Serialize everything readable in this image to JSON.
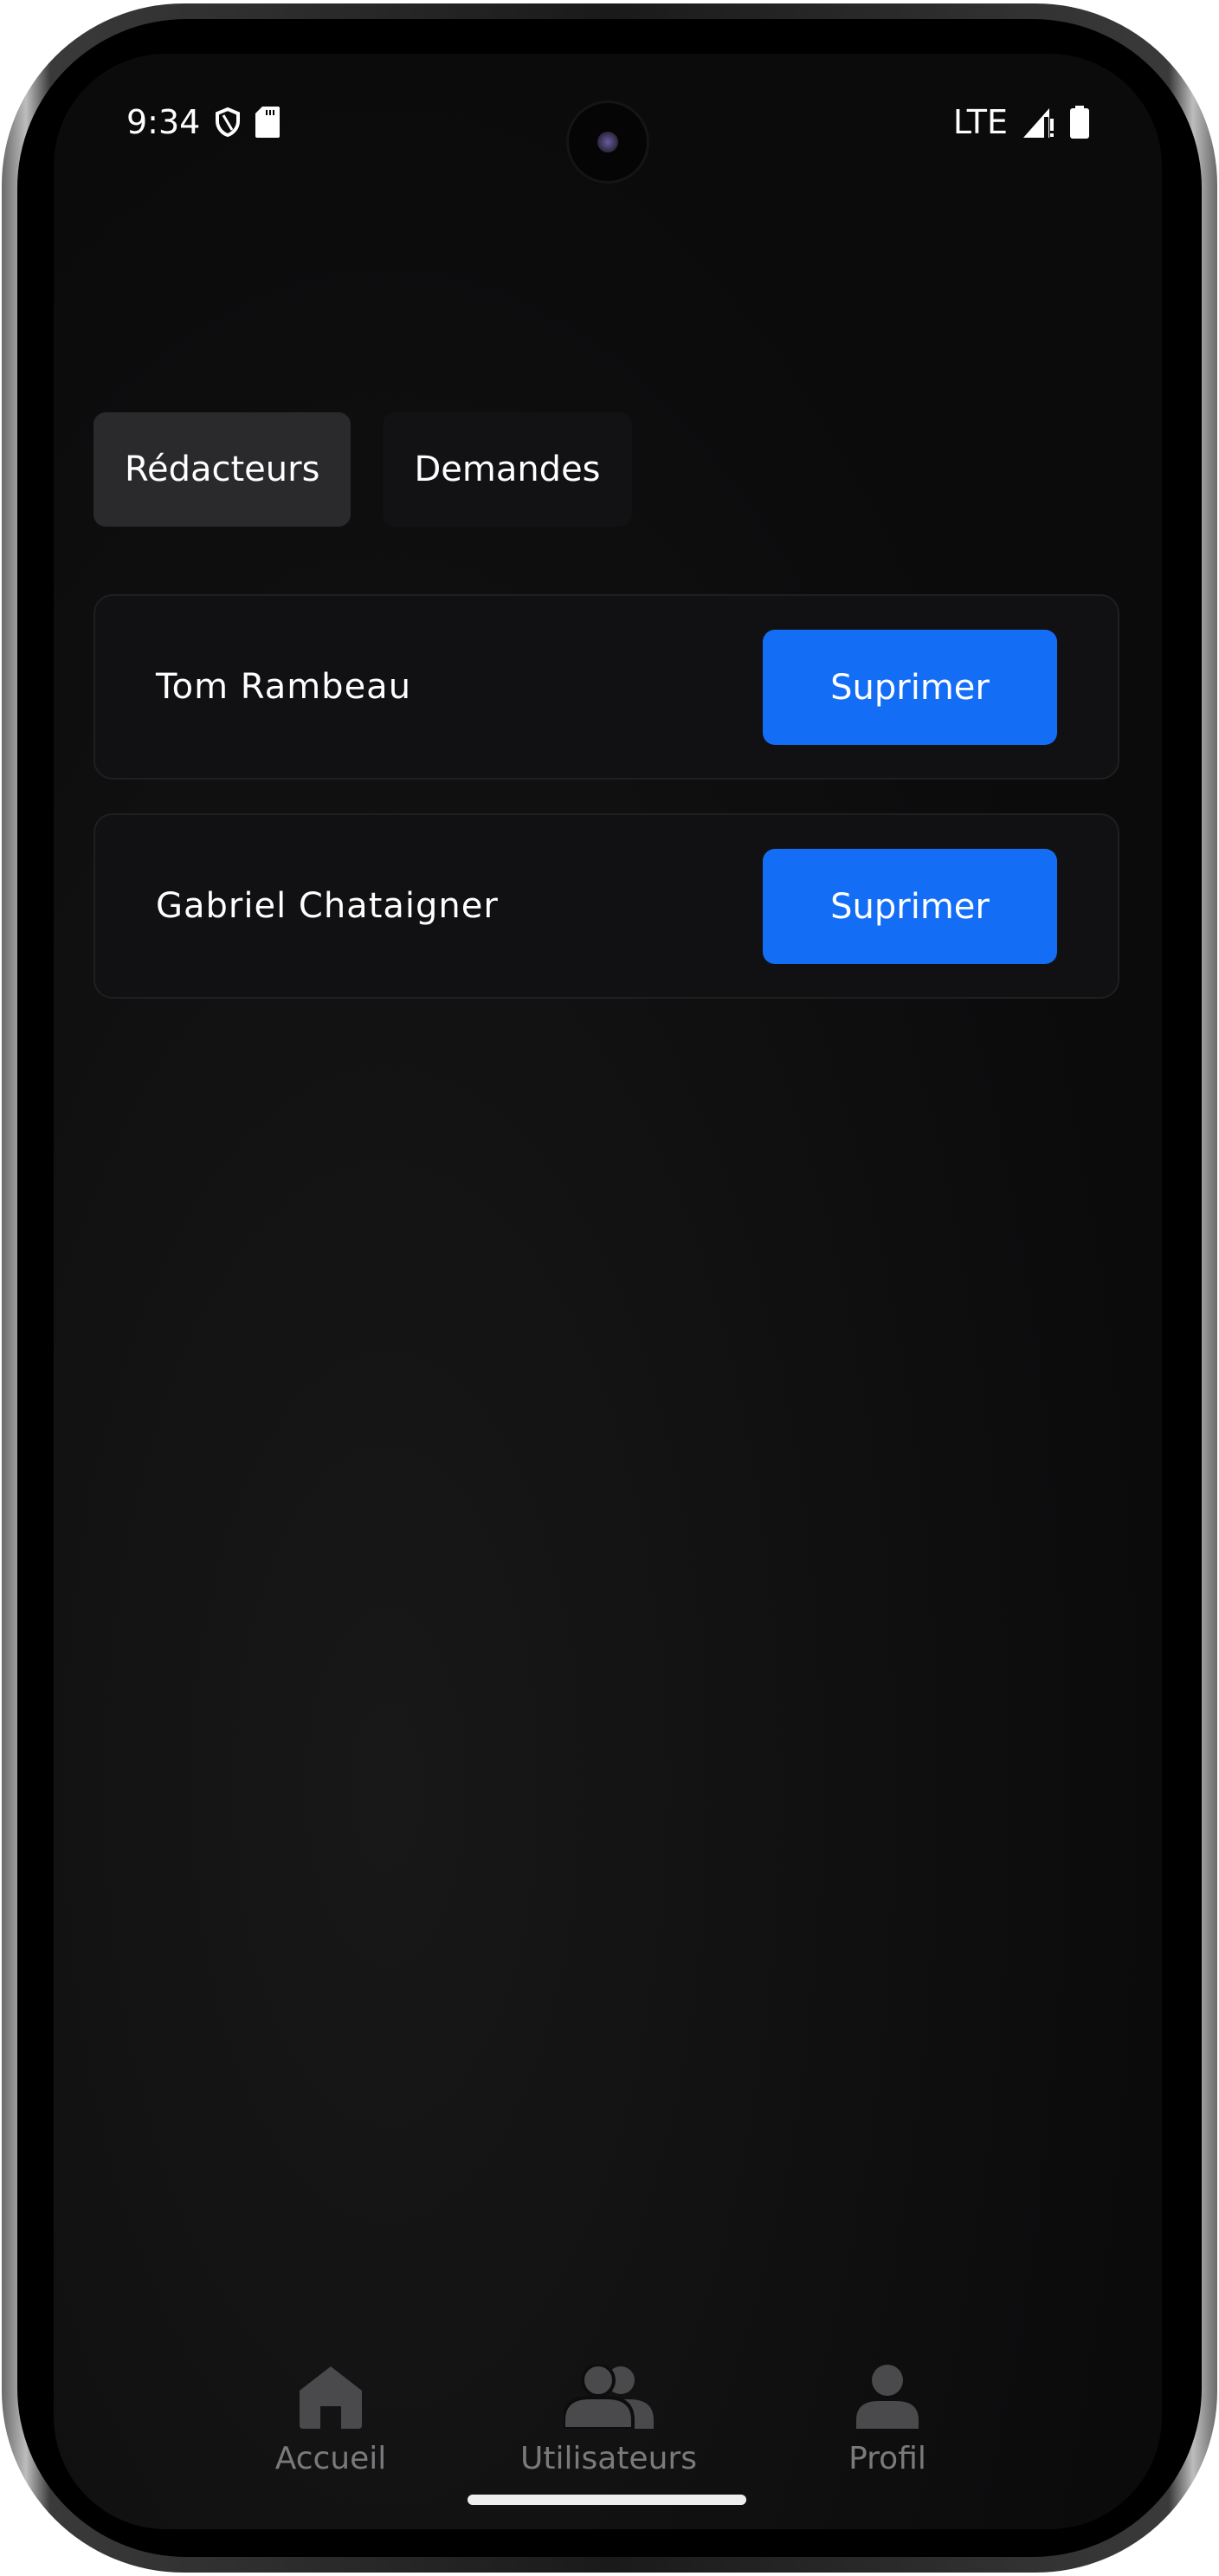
{
  "status_bar": {
    "time": "9:34",
    "network": "LTE",
    "icons": [
      "shield-icon",
      "sd-card-icon",
      "signal-icon",
      "battery-icon"
    ]
  },
  "tabs": [
    {
      "label": "Rédacteurs",
      "active": true
    },
    {
      "label": "Demandes",
      "active": false
    }
  ],
  "writers": [
    {
      "name": "Tom Rambeau",
      "action": "Suprimer"
    },
    {
      "name": "Gabriel Chataigner",
      "action": "Suprimer"
    }
  ],
  "nav": [
    {
      "label": "Accueil",
      "icon": "home-icon"
    },
    {
      "label": "Utilisateurs",
      "icon": "users-icon"
    },
    {
      "label": "Profil",
      "icon": "user-icon"
    }
  ],
  "colors": {
    "accent": "#146ef5",
    "background": "#0b0b0c",
    "nav_inactive": "#4a4a4c"
  }
}
